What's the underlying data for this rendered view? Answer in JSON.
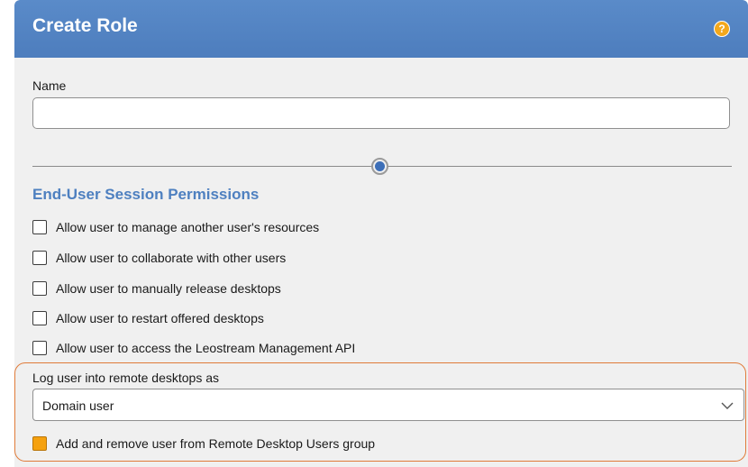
{
  "header": {
    "title": "Create Role",
    "help_glyph": "?"
  },
  "name_field": {
    "label": "Name",
    "value": "",
    "placeholder": ""
  },
  "section": {
    "title": "End-User Session Permissions"
  },
  "permissions": [
    {
      "label": "Allow user to manage another user's resources",
      "checked": false
    },
    {
      "label": "Allow user to collaborate with other users",
      "checked": false
    },
    {
      "label": "Allow user to manually release desktops",
      "checked": false
    },
    {
      "label": "Allow user to restart offered desktops",
      "checked": false
    },
    {
      "label": "Allow user to access the Leostream Management API",
      "checked": false
    }
  ],
  "remote_login": {
    "label": "Log user into remote desktops as",
    "selected": "Domain user",
    "group_option": {
      "label": "Add and remove user from Remote Desktop Users group",
      "checked": true
    }
  },
  "colors": {
    "header": "#4d7dbd",
    "section_title": "#4e80c0",
    "highlight_border": "#e07b39",
    "checked_fill": "#f5a10f",
    "help_icon": "#f2a81d"
  },
  "icons": {
    "help": "help-icon",
    "dropdown": "chevron-down-icon",
    "collapse_handle": "radio-knob-icon"
  }
}
